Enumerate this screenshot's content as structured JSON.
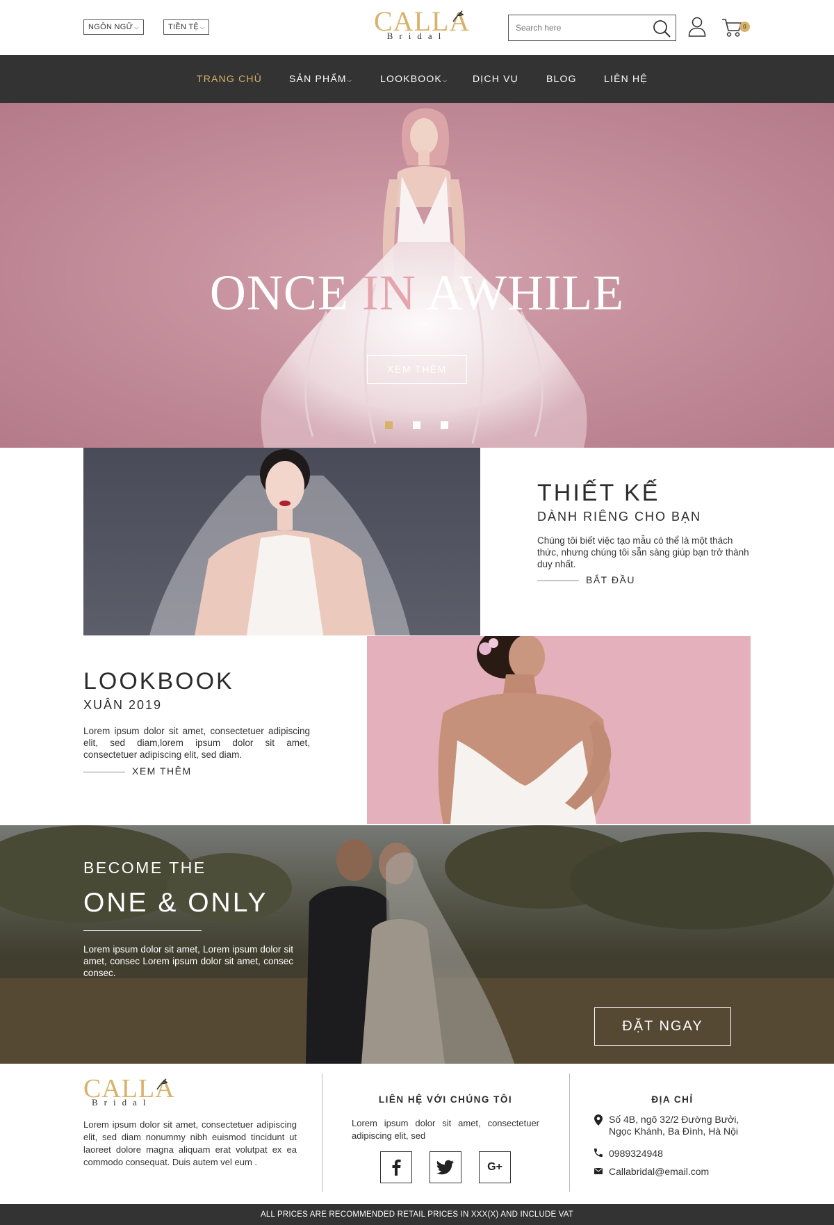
{
  "header": {
    "language_label": "NGÔN NGỮ",
    "currency_label": "TIỀN TỆ",
    "logo_text": "CALLA",
    "logo_sub": "Bridal",
    "search_placeholder": "Search here",
    "cart_count": "0"
  },
  "nav": {
    "items": [
      {
        "label": "TRANG CHỦ",
        "active": true
      },
      {
        "label": "SẢN PHẨM",
        "dropdown": true
      },
      {
        "label": "LOOKBOOK",
        "dropdown": true
      },
      {
        "label": "DỊCH VỤ"
      },
      {
        "label": "BLOG"
      },
      {
        "label": "LIÊN HỆ"
      }
    ]
  },
  "hero": {
    "title_part1": "ONCE ",
    "title_part2": "IN",
    "title_part3": " AWHILE",
    "button_label": "XEM THÊM",
    "active_slide": 1,
    "slide_count": 3
  },
  "design": {
    "title": "THIẾT KẾ",
    "subtitle": "DÀNH RIÊNG CHO BẠN",
    "text": "Chúng tôi biết việc tạo mẫu có thể là một thách thức, nhưng chúng tôi sẵn sàng giúp bạn trở thành duy nhất.",
    "link": "BẮT ĐẦU"
  },
  "lookbook": {
    "title": "LOOKBOOK",
    "subtitle": "XUÂN 2019",
    "text": "Lorem ipsum dolor sit amet, consectetuer adipiscing elit, sed diam,lorem ipsum dolor sit amet, consectetuer adipiscing elit, sed diam.",
    "link": "XEM THÊM"
  },
  "banner": {
    "small": "BECOME THE",
    "big": "ONE & ONLY",
    "text": "Lorem ipsum dolor sit amet, Lorem ipsum dolor sit amet, consec Lorem ipsum dolor sit amet, consec consec.",
    "button_label": "ĐẶT NGAY"
  },
  "footer": {
    "logo_text": "CALLA",
    "logo_sub": "Bridal",
    "about": "Lorem ipsum dolor sit amet, consectetuer adipiscing elit, sed diam nonummy nibh euismod tincidunt ut laoreet dolore magna aliquam erat volutpat ex ea commodo consequat. Duis autem vel eum .",
    "contact_heading": "LIÊN HỆ VỚI CHÚNG TÔI",
    "contact_text": "Lorem ipsum dolor sit amet, consectetuer adipiscing elit, sed",
    "social": [
      "facebook-icon",
      "twitter-icon",
      "google-plus-icon"
    ],
    "address_heading": "ĐỊA CHỈ",
    "address_line1": "Số 4B, ngõ 32/2 Đường Bưởi,",
    "address_line2": "Ngọc Khánh, Ba Đình, Hà Nội",
    "phone": "0989324948",
    "email": "Callabridal@email.com"
  },
  "bottom_bar": "ALL PRICES ARE RECOMMENDED RETAIL PRICES IN XXX(X) AND INCLUDE VAT",
  "colors": {
    "accent_gold": "#d8b26a",
    "nav_bg": "#333333",
    "hero_pink": "#c58f9c"
  }
}
